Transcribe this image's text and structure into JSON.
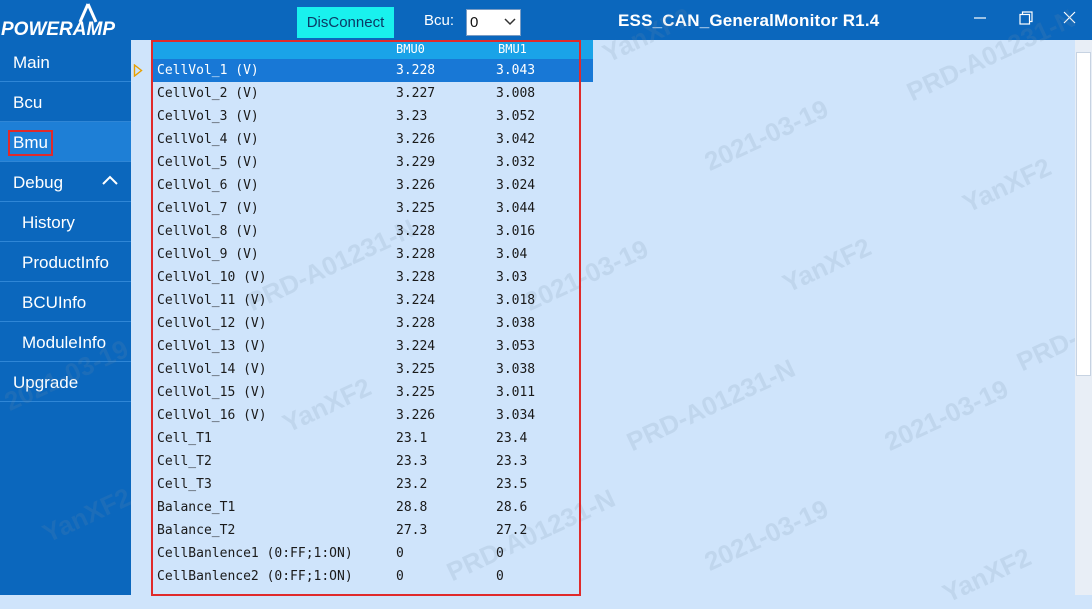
{
  "window": {
    "logo_text": "POWERAMP",
    "title": "ESS_CAN_GeneralMonitor R1.4",
    "disconnect_label": "DisConnect",
    "bcu_label": "Bcu:",
    "bcu_value": "0"
  },
  "sidebar": {
    "items": [
      {
        "label": "Main"
      },
      {
        "label": "Bcu"
      },
      {
        "label": "Bmu"
      },
      {
        "label": "Debug"
      },
      {
        "label": "History"
      },
      {
        "label": "ProductInfo"
      },
      {
        "label": "BCUInfo"
      },
      {
        "label": "ModuleInfo"
      },
      {
        "label": "Upgrade"
      }
    ]
  },
  "grid": {
    "columns": [
      "BMU0",
      "BMU1"
    ],
    "rows": [
      {
        "name": "CellVol_1 (V)",
        "bmu0": "3.228",
        "bmu1": "3.043"
      },
      {
        "name": "CellVol_2 (V)",
        "bmu0": "3.227",
        "bmu1": "3.008"
      },
      {
        "name": "CellVol_3 (V)",
        "bmu0": "3.23",
        "bmu1": "3.052"
      },
      {
        "name": "CellVol_4 (V)",
        "bmu0": "3.226",
        "bmu1": "3.042"
      },
      {
        "name": "CellVol_5 (V)",
        "bmu0": "3.229",
        "bmu1": "3.032"
      },
      {
        "name": "CellVol_6 (V)",
        "bmu0": "3.226",
        "bmu1": "3.024"
      },
      {
        "name": "CellVol_7 (V)",
        "bmu0": "3.225",
        "bmu1": "3.044"
      },
      {
        "name": "CellVol_8 (V)",
        "bmu0": "3.228",
        "bmu1": "3.016"
      },
      {
        "name": "CellVol_9 (V)",
        "bmu0": "3.228",
        "bmu1": "3.04"
      },
      {
        "name": "CellVol_10 (V)",
        "bmu0": "3.228",
        "bmu1": "3.03"
      },
      {
        "name": "CellVol_11 (V)",
        "bmu0": "3.224",
        "bmu1": "3.018"
      },
      {
        "name": "CellVol_12 (V)",
        "bmu0": "3.228",
        "bmu1": "3.038"
      },
      {
        "name": "CellVol_13 (V)",
        "bmu0": "3.224",
        "bmu1": "3.053"
      },
      {
        "name": "CellVol_14 (V)",
        "bmu0": "3.225",
        "bmu1": "3.038"
      },
      {
        "name": "CellVol_15 (V)",
        "bmu0": "3.225",
        "bmu1": "3.011"
      },
      {
        "name": "CellVol_16 (V)",
        "bmu0": "3.226",
        "bmu1": "3.034"
      },
      {
        "name": "Cell_T1",
        "bmu0": "23.1",
        "bmu1": "23.4"
      },
      {
        "name": "Cell_T2",
        "bmu0": "23.3",
        "bmu1": "23.3"
      },
      {
        "name": "Cell_T3",
        "bmu0": "23.2",
        "bmu1": "23.5"
      },
      {
        "name": "Balance_T1",
        "bmu0": "28.8",
        "bmu1": "28.6"
      },
      {
        "name": "Balance_T2",
        "bmu0": "27.3",
        "bmu1": "27.2"
      },
      {
        "name": "CellBanlence1 (0:FF;1:ON)",
        "bmu0": "0",
        "bmu1": "0"
      },
      {
        "name": "CellBanlence2 (0:FF;1:ON)",
        "bmu0": "0",
        "bmu1": "0"
      }
    ]
  },
  "watermark": {
    "user": "YanXF2",
    "doc": "PRD-A01231-N",
    "date": "2021-03-19"
  },
  "colors": {
    "titlebar": "#0b67bd",
    "content_bg": "#cfe4fb",
    "header_row": "#1aa3e8",
    "selected_row": "#1878d6",
    "disconnect_button": "#19f1ee",
    "highlight_frame": "#e02a2a"
  }
}
